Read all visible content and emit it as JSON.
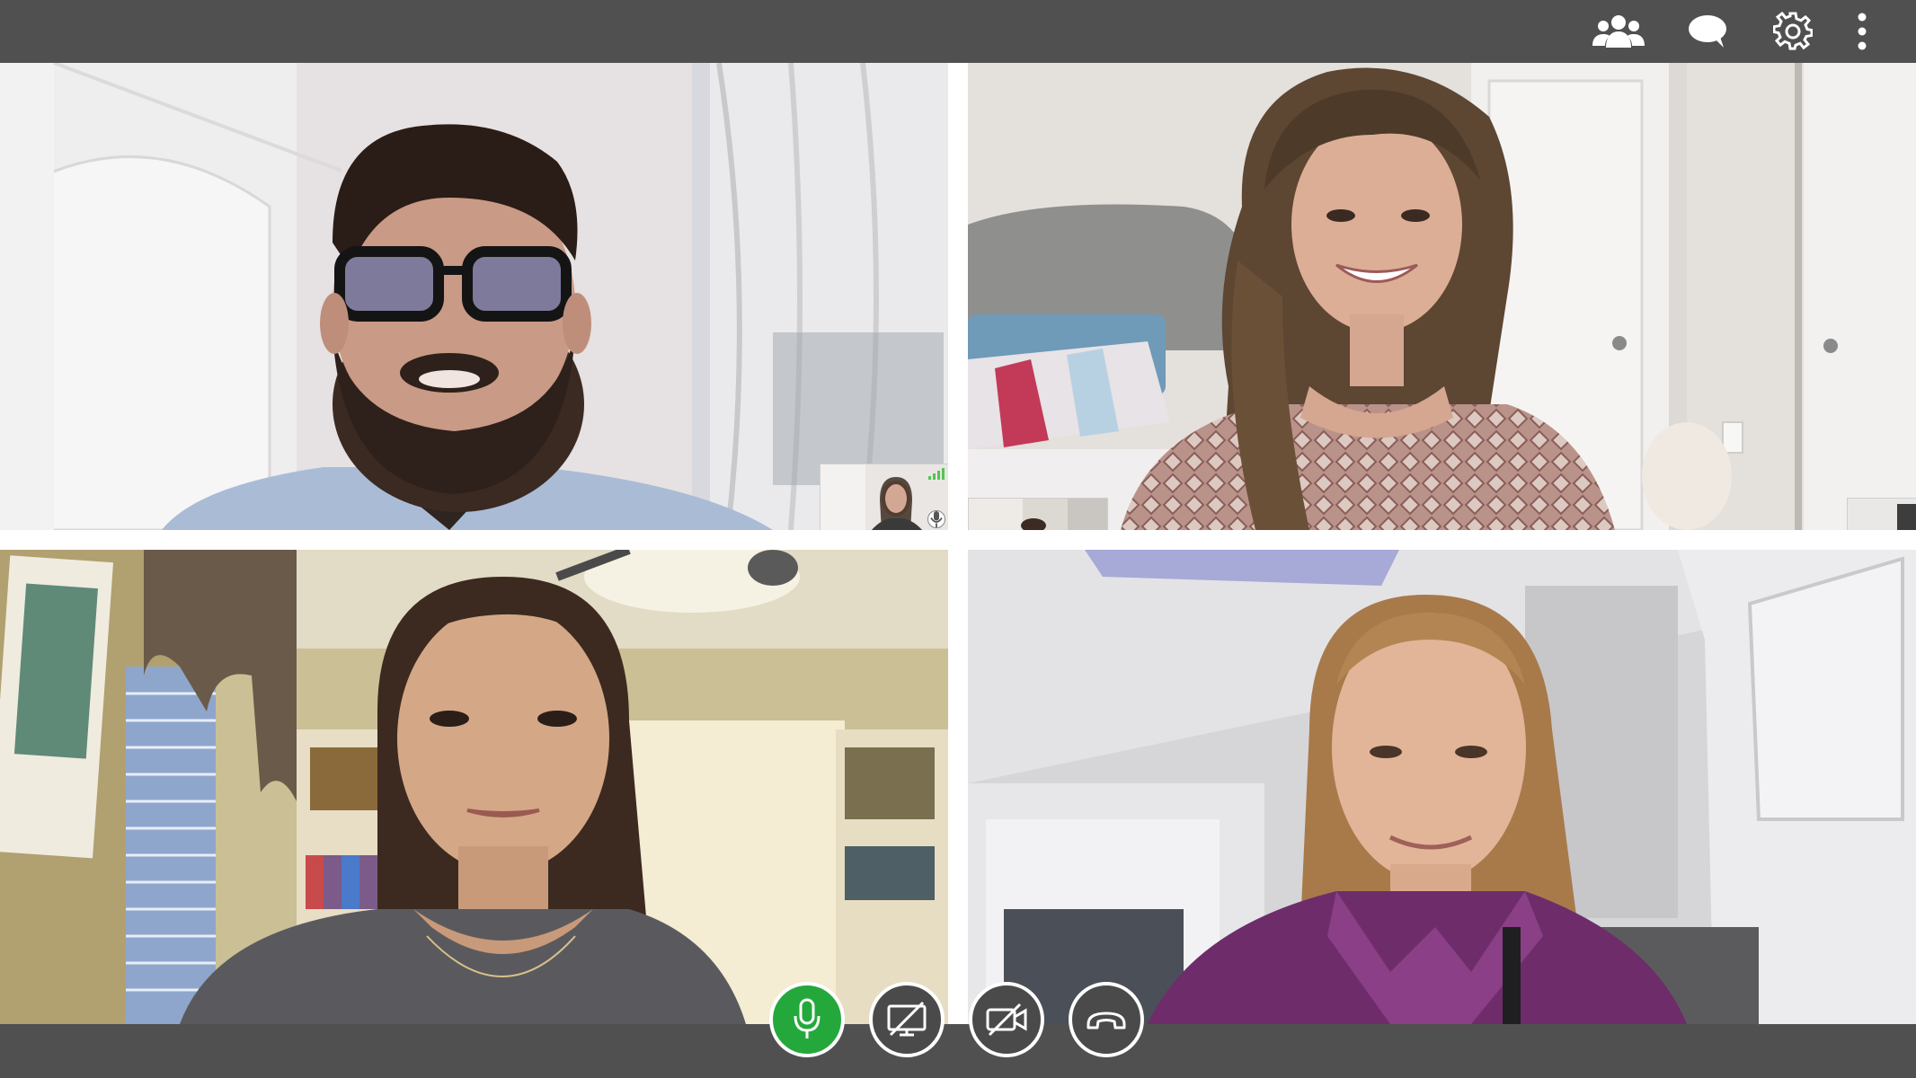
{
  "toolbar": {
    "icons": [
      "participants-icon",
      "chat-icon",
      "settings-icon",
      "more-icon"
    ]
  },
  "participants": [
    {
      "tile": 1,
      "camera": "on",
      "self_view": true
    },
    {
      "tile": 2,
      "camera": "on",
      "self_view": true
    },
    {
      "tile": 3,
      "camera": "on",
      "self_view": false
    },
    {
      "tile": 4,
      "camera": "on",
      "self_view": false
    }
  ],
  "controls": {
    "mic": {
      "icon": "microphone-icon",
      "state": "on",
      "color": "#24a83c"
    },
    "screen_share": {
      "icon": "screen-share-off-icon",
      "state": "off"
    },
    "video": {
      "icon": "video-off-icon",
      "state": "off"
    },
    "hangup": {
      "icon": "phone-hangup-icon"
    }
  },
  "colors": {
    "bar": "#505050",
    "mic_active": "#24a83c",
    "button_dark": "#4a4a4a",
    "signal": "#56c356"
  }
}
